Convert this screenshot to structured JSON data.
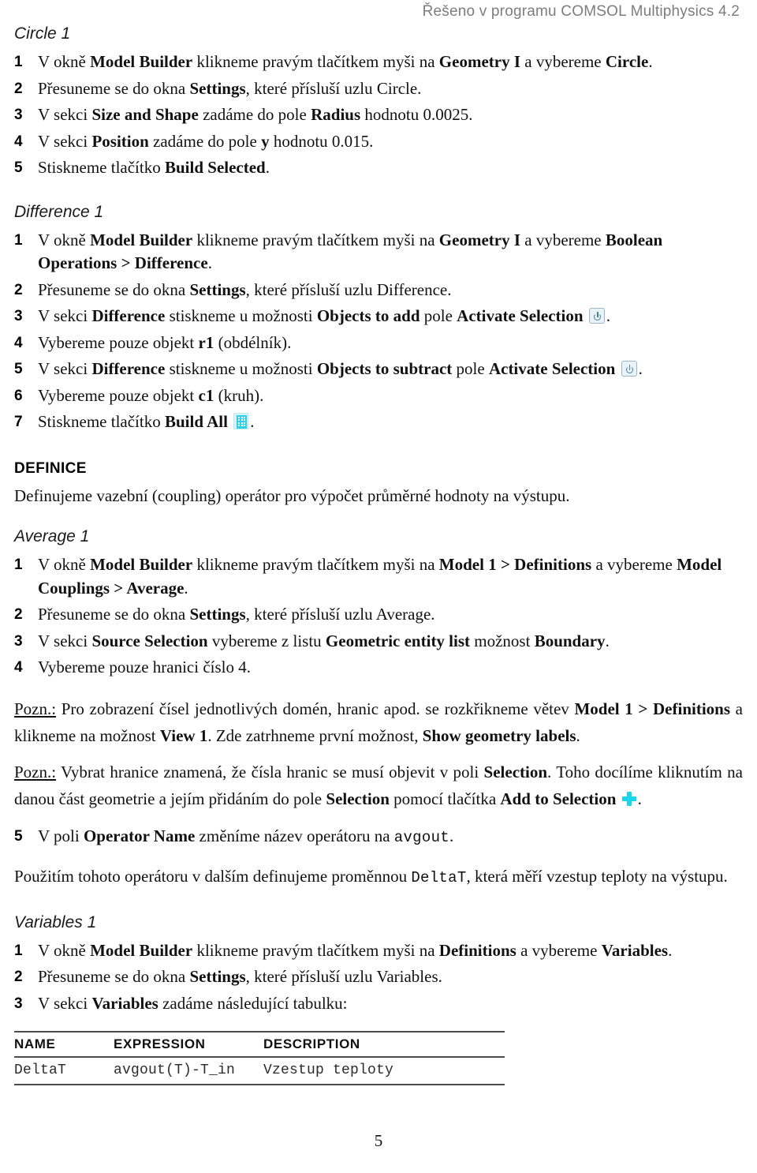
{
  "header": {
    "running_title": "Řešeno v programu COMSOL Multiphysics 4.2"
  },
  "sections": [
    {
      "id": "circle1",
      "title": "Circle 1",
      "steps": [
        {
          "num": "1",
          "parts": [
            {
              "t": "V okně ",
              "b": false
            },
            {
              "t": "Model Builder",
              "b": true
            },
            {
              "t": " klikneme pravým tlačítkem myši na ",
              "b": false
            },
            {
              "t": "Geometry I",
              "b": true
            },
            {
              "t": " a vybereme ",
              "b": false
            },
            {
              "t": "Circle",
              "b": true
            },
            {
              "t": ".",
              "b": false
            }
          ]
        },
        {
          "num": "2",
          "parts": [
            {
              "t": "Přesuneme se do okna ",
              "b": false
            },
            {
              "t": "Settings",
              "b": true
            },
            {
              "t": ", které přísluší uzlu Circle.",
              "b": false
            }
          ]
        },
        {
          "num": "3",
          "parts": [
            {
              "t": "V sekci ",
              "b": false
            },
            {
              "t": "Size and Shape",
              "b": true
            },
            {
              "t": " zadáme do pole ",
              "b": false
            },
            {
              "t": "Radius",
              "b": true
            },
            {
              "t": " hodnotu 0.0025.",
              "b": false
            }
          ]
        },
        {
          "num": "4",
          "parts": [
            {
              "t": "V sekci ",
              "b": false
            },
            {
              "t": "Position",
              "b": true
            },
            {
              "t": " zadáme do pole ",
              "b": false
            },
            {
              "t": "y",
              "b": true
            },
            {
              "t": " hodnotu 0.015.",
              "b": false
            }
          ]
        },
        {
          "num": "5",
          "parts": [
            {
              "t": "Stiskneme tlačítko ",
              "b": false
            },
            {
              "t": "Build Selected",
              "b": true
            },
            {
              "t": ".",
              "b": false
            }
          ]
        }
      ]
    },
    {
      "id": "difference1",
      "title": "Difference 1",
      "steps": [
        {
          "num": "1",
          "parts": [
            {
              "t": "V okně ",
              "b": false
            },
            {
              "t": "Model Builder",
              "b": true
            },
            {
              "t": " klikneme pravým tlačítkem myši na ",
              "b": false
            },
            {
              "t": "Geometry I",
              "b": true
            },
            {
              "t": " a vybereme ",
              "b": false
            },
            {
              "t": "Boolean Operations > Difference",
              "b": true
            },
            {
              "t": ".",
              "b": false
            }
          ]
        },
        {
          "num": "2",
          "parts": [
            {
              "t": "Přesuneme se do okna ",
              "b": false
            },
            {
              "t": "Settings",
              "b": true
            },
            {
              "t": ", které přísluší uzlu Difference.",
              "b": false
            }
          ]
        },
        {
          "num": "3",
          "icon": "power-icon",
          "parts": [
            {
              "t": "V sekci ",
              "b": false
            },
            {
              "t": "Difference",
              "b": true
            },
            {
              "t": " stiskneme u možnosti ",
              "b": false
            },
            {
              "t": "Objects to add",
              "b": true
            },
            {
              "t": " pole ",
              "b": false
            },
            {
              "t": "Activate Selection",
              "b": true
            },
            {
              "t": " ",
              "b": false
            }
          ],
          "tail": "."
        },
        {
          "num": "4",
          "parts": [
            {
              "t": "Vybereme pouze objekt ",
              "b": false
            },
            {
              "t": "r1",
              "b": true
            },
            {
              "t": " (obdélník).",
              "b": false
            }
          ]
        },
        {
          "num": "5",
          "icon": "power-icon",
          "parts": [
            {
              "t": "V sekci ",
              "b": false
            },
            {
              "t": "Difference",
              "b": true
            },
            {
              "t": " stiskneme u možnosti ",
              "b": false
            },
            {
              "t": "Objects to subtract",
              "b": true
            },
            {
              "t": " pole ",
              "b": false
            },
            {
              "t": "Activate Selection",
              "b": true
            },
            {
              "t": " ",
              "b": false
            }
          ],
          "tail": "."
        },
        {
          "num": "6",
          "parts": [
            {
              "t": "Vybereme pouze objekt ",
              "b": false
            },
            {
              "t": "c1",
              "b": true
            },
            {
              "t": " (kruh).",
              "b": false
            }
          ]
        },
        {
          "num": "7",
          "icon": "build-all-icon",
          "parts": [
            {
              "t": "Stiskneme tlačítko ",
              "b": false
            },
            {
              "t": "Build All",
              "b": true
            },
            {
              "t": " ",
              "b": false
            }
          ],
          "tail": "."
        }
      ]
    },
    {
      "id": "definice",
      "title": "DEFINICE",
      "intro": "Definujeme vazební (coupling) operátor pro výpočet průměrné hodnoty na výstupu."
    },
    {
      "id": "average1",
      "title": "Average 1",
      "steps": [
        {
          "num": "1",
          "parts": [
            {
              "t": "V okně ",
              "b": false
            },
            {
              "t": "Model Builder",
              "b": true
            },
            {
              "t": " klikneme pravým tlačítkem myši na ",
              "b": false
            },
            {
              "t": "Model 1 > Definitions",
              "b": true
            },
            {
              "t": " a vybereme ",
              "b": false
            },
            {
              "t": "Model Couplings > Average",
              "b": true
            },
            {
              "t": ".",
              "b": false
            }
          ]
        },
        {
          "num": "2",
          "parts": [
            {
              "t": "Přesuneme se do okna ",
              "b": false
            },
            {
              "t": "Settings",
              "b": true
            },
            {
              "t": ", které přísluší uzlu Average.",
              "b": false
            }
          ]
        },
        {
          "num": "3",
          "parts": [
            {
              "t": "V sekci ",
              "b": false
            },
            {
              "t": "Source Selection",
              "b": true
            },
            {
              "t": " vybereme z listu ",
              "b": false
            },
            {
              "t": "Geometric entity list",
              "b": true
            },
            {
              "t": " možnost ",
              "b": false
            },
            {
              "t": "Boundary",
              "b": true
            },
            {
              "t": ".",
              "b": false
            }
          ]
        },
        {
          "num": "4",
          "parts": [
            {
              "t": "Vybereme pouze hranici číslo 4.",
              "b": false
            }
          ]
        }
      ]
    }
  ],
  "notes": [
    {
      "id": "pozn-1",
      "label": "Pozn.:",
      "parts": [
        {
          "t": " Pro zobrazení čísel jednotlivých domén, hranic apod. se rozkřikneme větev ",
          "b": false
        },
        {
          "t": "Model 1 > Definitions",
          "b": true
        },
        {
          "t": " a klikneme na možnost ",
          "b": false
        },
        {
          "t": "View 1",
          "b": true
        },
        {
          "t": ". Zde zatrhneme první možnost, ",
          "b": false
        },
        {
          "t": "Show geometry labels",
          "b": true
        },
        {
          "t": ".",
          "b": false
        }
      ]
    },
    {
      "id": "pozn-2",
      "label": "Pozn.:",
      "icon": "add-to-selection-icon",
      "parts": [
        {
          "t": " Vybrat hranice znamená, že čísla hranic se musí objevit v poli ",
          "b": false
        },
        {
          "t": "Selection",
          "b": true
        },
        {
          "t": ". Toho docílíme kliknutím na danou část geometrie a jejím přidáním do pole ",
          "b": false
        },
        {
          "t": "Selection",
          "b": true
        },
        {
          "t": " pomocí tlačítka ",
          "b": false
        },
        {
          "t": "Add to Selection",
          "b": true
        },
        {
          "t": " ",
          "b": false
        }
      ],
      "tail": "."
    }
  ],
  "step5_operator": {
    "num": "5",
    "parts": [
      {
        "t": "V poli ",
        "b": false
      },
      {
        "t": "Operator Name",
        "b": true
      },
      {
        "t": " změníme název operátoru na ",
        "b": false
      }
    ],
    "mono_value": "avgout",
    "tail": "."
  },
  "paragraph_usage": {
    "pre": "Použitím tohoto operátoru v dalším definujeme proměnnou ",
    "mono_value": "DeltaT",
    "post": ", která měří vzestup teploty na výstupu."
  },
  "variables_section": {
    "title": "Variables 1",
    "steps": [
      {
        "num": "1",
        "parts": [
          {
            "t": "V okně ",
            "b": false
          },
          {
            "t": "Model Builder",
            "b": true
          },
          {
            "t": " klikneme pravým tlačítkem myši na ",
            "b": false
          },
          {
            "t": "Definitions",
            "b": true
          },
          {
            "t": " a vybereme ",
            "b": false
          },
          {
            "t": "Variables",
            "b": true
          },
          {
            "t": ".",
            "b": false
          }
        ]
      },
      {
        "num": "2",
        "parts": [
          {
            "t": "Přesuneme se do okna ",
            "b": false
          },
          {
            "t": "Settings",
            "b": true
          },
          {
            "t": ", které přísluší uzlu Variables.",
            "b": false
          }
        ]
      },
      {
        "num": "3",
        "parts": [
          {
            "t": "V sekci ",
            "b": false
          },
          {
            "t": "Variables",
            "b": true
          },
          {
            "t": " zadáme následující tabulku:",
            "b": false
          }
        ]
      }
    ],
    "table": {
      "columns": [
        "NAME",
        "EXPRESSION",
        "DESCRIPTION"
      ],
      "rows": [
        [
          "DeltaT",
          "avgout(T)-T_in",
          "Vzestup teploty"
        ]
      ]
    }
  },
  "footer": {
    "page_number": "5"
  },
  "colors": {
    "header_gray": "#7d7d7d",
    "icon_cyan": "#1ad6ec",
    "icon_power_border": "#9ab7c9",
    "rule": "#4a4a4a"
  }
}
